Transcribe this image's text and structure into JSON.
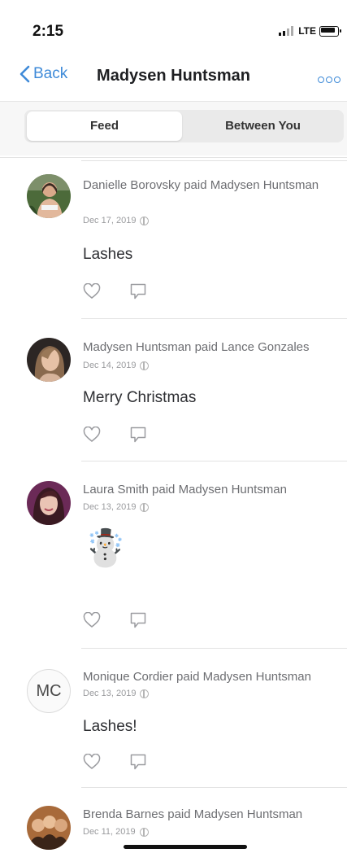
{
  "status_bar": {
    "time": "2:15",
    "network": "LTE"
  },
  "nav": {
    "back_label": "Back",
    "title": "Madysen Huntsman",
    "more_icon": "more-icon"
  },
  "tabs": [
    {
      "label": "Feed",
      "active": true
    },
    {
      "label": "Between You",
      "active": false
    }
  ],
  "feed": [
    {
      "headline": "Danielle Borovsky paid Madysen Huntsman",
      "date": "Dec 17, 2019",
      "note": "Lashes"
    },
    {
      "headline": "Madysen Huntsman paid Lance Gonzales",
      "date": "Dec 14, 2019",
      "note": "Merry Christmas"
    },
    {
      "headline": "Laura Smith paid Madysen Huntsman",
      "date": "Dec 13, 2019",
      "note": "☃️"
    },
    {
      "headline": "Monique Cordier paid Madysen Huntsman",
      "date": "Dec 13, 2019",
      "note": "Lashes!",
      "initials": "MC"
    },
    {
      "headline": "Brenda Barnes paid Madysen Huntsman",
      "date": "Dec 11, 2019"
    }
  ],
  "colors": {
    "accent": "#3e8ad8",
    "text_secondary": "#6d6e72",
    "text_muted": "#9a9b9e"
  }
}
